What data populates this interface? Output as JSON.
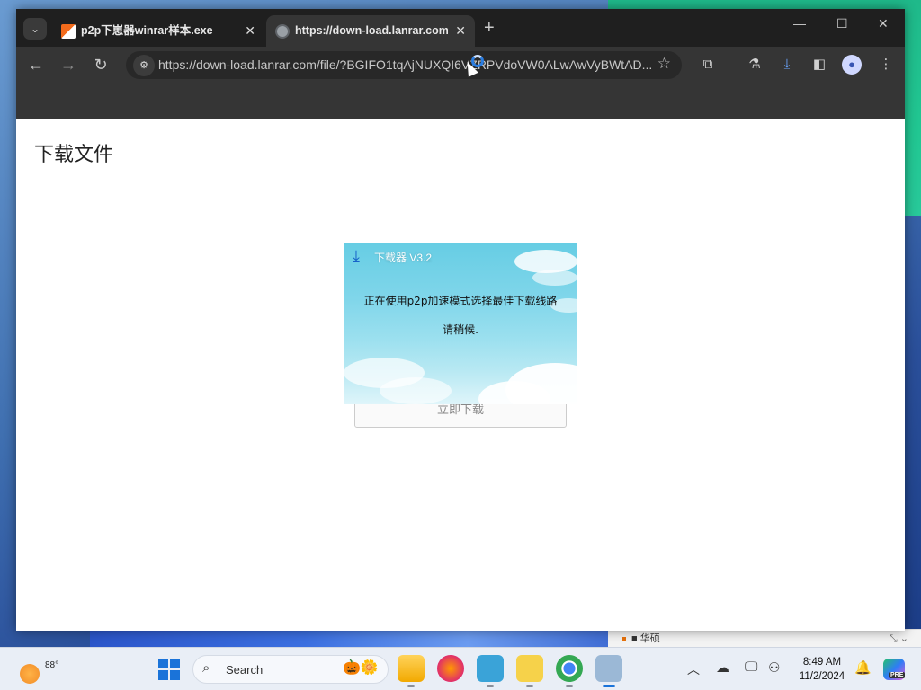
{
  "browser": {
    "tabs": [
      {
        "title": "p2p下崽器winrar样本.exe",
        "active": false
      },
      {
        "title": "https://down-load.lanrar.com/",
        "active": true
      }
    ],
    "url": "https://down-load.lanrar.com/file/?BGIFO1tqAjNUXQI6VZRPVdoVW0ALwAwVyBWtAD..."
  },
  "page": {
    "title": "下载文件",
    "download_button_label": "立即下载"
  },
  "dialog": {
    "title": "下载器 V3.2",
    "message": "正在使用p2p加速模式选择最佳下载线路",
    "wait": "请稍候."
  },
  "desktop": {
    "background_window_label": "■ 华硕"
  },
  "taskbar": {
    "weather_temp": "88°",
    "search_label": "Search",
    "clock_time": "8:49 AM",
    "clock_date": "11/2/2024",
    "copilot_badge": "PRE"
  },
  "colors": {
    "accent": "#1a73d9",
    "titlebar": "#1f1f1f",
    "toolbar": "#353535",
    "dialog_sky": "#80d6ea"
  }
}
